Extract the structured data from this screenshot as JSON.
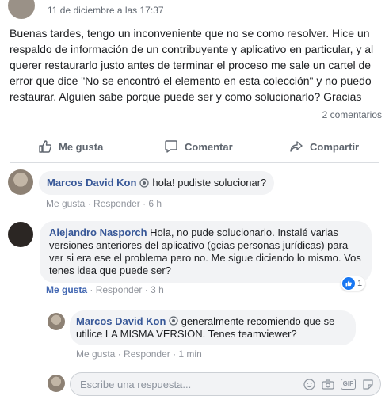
{
  "post": {
    "date": "11 de diciembre a las 17:37",
    "text": "Buenas tardes, tengo un inconveniente que no se como resolver. Hice un respaldo de información de un contribuyente y aplicativo en particular, y al querer restaurarlo justo antes de terminar el proceso me sale un cartel de error que dice \"No se encontró el elemento en esta colección\" y no puedo restaurar. Alguien sabe porque puede ser y como solucionarlo? Gracias",
    "comment_count": "2 comentarios"
  },
  "actions": {
    "like": "Me gusta",
    "comment": "Comentar",
    "share": "Compartir"
  },
  "comments": [
    {
      "author": "Marcos David Kon",
      "text": "hola! pudiste solucionar?",
      "like": "Me gusta",
      "reply": "Responder",
      "time": "6 h"
    },
    {
      "author": "Alejandro Nasporch",
      "text": "Hola, no pude solucionarlo. Instalé varias versiones anteriores del aplicativo (gcias personas jurídicas) para ver si era ese el problema pero no. Me sigue diciendo lo mismo. Vos tenes idea que puede ser?",
      "like": "Me gusta",
      "reply": "Responder",
      "time": "3 h",
      "reactions": "1"
    },
    {
      "author": "Marcos David Kon",
      "text": "generalmente recomiendo que se utilice LA MISMA VERSION. Tenes teamviewer?",
      "like": "Me gusta",
      "reply": "Responder",
      "time": "1 min"
    }
  ],
  "reply_input": {
    "placeholder": "Escribe una respuesta..."
  },
  "colors": {
    "link": "#385898",
    "like_blue": "#1877f2"
  }
}
